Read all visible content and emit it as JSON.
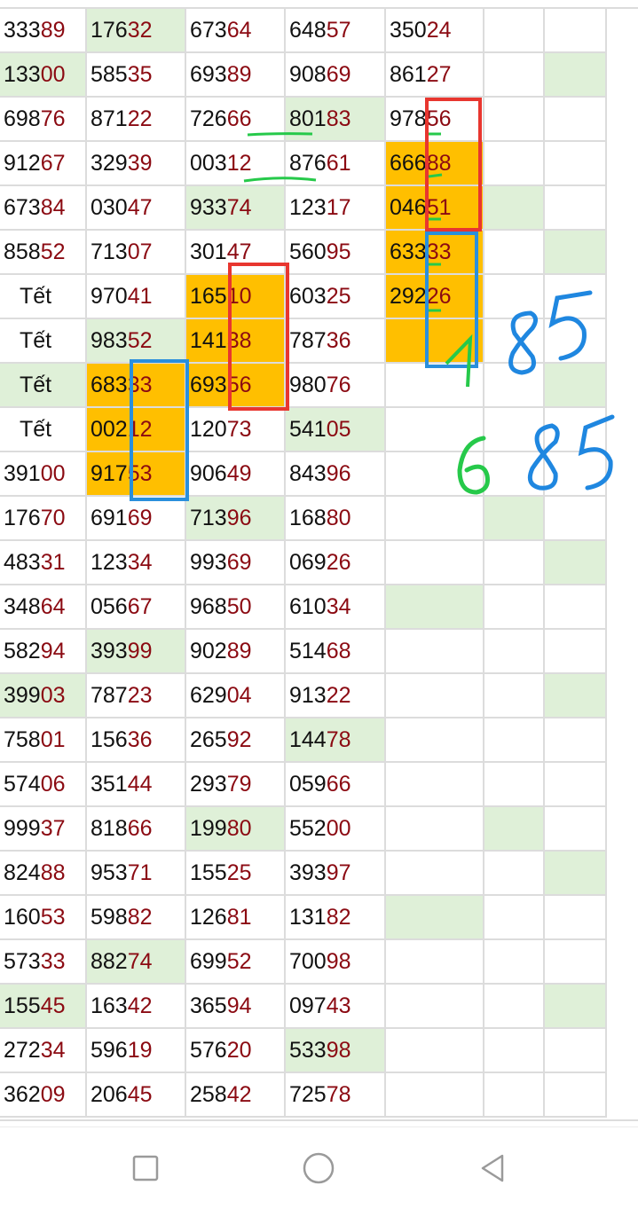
{
  "colors": {
    "grid_line": "#dcdcdc",
    "highlight_green": "#dff0d8",
    "highlight_orange": "#ffbf00",
    "tail_red": "#8b0a12",
    "box_red": "#e8362f",
    "box_blue": "#2a8fdc",
    "ink_green": "#26c94a",
    "ink_blue": "#1f87e0"
  },
  "table": {
    "rows": [
      [
        "33389",
        "17632",
        "67364",
        "64857",
        "35024",
        "",
        ""
      ],
      [
        "13300",
        "58535",
        "69389",
        "90869",
        "86127",
        "",
        ""
      ],
      [
        "69876",
        "87122",
        "72666",
        "80183",
        "97856",
        "",
        ""
      ],
      [
        "91267",
        "32939",
        "00312",
        "87661",
        "66688",
        "",
        ""
      ],
      [
        "67384",
        "03047",
        "93374",
        "12317",
        "04651",
        "",
        ""
      ],
      [
        "85852",
        "71307",
        "30147",
        "56095",
        "63333",
        "",
        ""
      ],
      [
        "Tết",
        "97041",
        "16510",
        "60325",
        "29226",
        "",
        ""
      ],
      [
        "Tết",
        "98352",
        "14138",
        "78736",
        "",
        "",
        ""
      ],
      [
        "Tết",
        "68333",
        "69356",
        "98076",
        "",
        "",
        ""
      ],
      [
        "Tết",
        "00212",
        "12073",
        "54105",
        "",
        "",
        ""
      ],
      [
        "39100",
        "91753",
        "90649",
        "84396",
        "",
        "",
        ""
      ],
      [
        "17670",
        "69169",
        "71396",
        "16880",
        "",
        "",
        ""
      ],
      [
        "48331",
        "12334",
        "99369",
        "06926",
        "",
        "",
        ""
      ],
      [
        "34864",
        "05667",
        "96850",
        "61034",
        "",
        "",
        ""
      ],
      [
        "58294",
        "39399",
        "90289",
        "51468",
        "",
        "",
        ""
      ],
      [
        "39903",
        "78723",
        "62904",
        "91322",
        "",
        "",
        ""
      ],
      [
        "75801",
        "15636",
        "26592",
        "14478",
        "",
        "",
        ""
      ],
      [
        "57406",
        "35144",
        "29379",
        "05966",
        "",
        "",
        ""
      ],
      [
        "99937",
        "81866",
        "19980",
        "55200",
        "",
        "",
        ""
      ],
      [
        "82488",
        "95371",
        "15525",
        "39397",
        "",
        "",
        ""
      ],
      [
        "16053",
        "59882",
        "12681",
        "13182",
        "",
        "",
        ""
      ],
      [
        "57333",
        "88274",
        "69952",
        "70098",
        "",
        "",
        ""
      ],
      [
        "15545",
        "16342",
        "36594",
        "09743",
        "",
        "",
        ""
      ],
      [
        "27234",
        "59619",
        "57620",
        "53398",
        "",
        "",
        ""
      ],
      [
        "36209",
        "20645",
        "25842",
        "72578",
        "",
        "",
        ""
      ]
    ],
    "green_cells": [
      [
        0,
        1
      ],
      [
        1,
        0
      ],
      [
        1,
        6
      ],
      [
        2,
        3
      ],
      [
        4,
        2
      ],
      [
        4,
        5
      ],
      [
        5,
        6
      ],
      [
        7,
        1
      ],
      [
        8,
        0
      ],
      [
        8,
        6
      ],
      [
        9,
        3
      ],
      [
        11,
        2
      ],
      [
        11,
        5
      ],
      [
        12,
        6
      ],
      [
        13,
        4
      ],
      [
        14,
        1
      ],
      [
        15,
        0
      ],
      [
        15,
        6
      ],
      [
        16,
        3
      ],
      [
        18,
        2
      ],
      [
        18,
        5
      ],
      [
        19,
        6
      ],
      [
        20,
        4
      ],
      [
        21,
        1
      ],
      [
        22,
        0
      ],
      [
        22,
        6
      ],
      [
        23,
        3
      ]
    ],
    "orange_cells": [
      [
        3,
        4
      ],
      [
        4,
        4
      ],
      [
        5,
        4
      ],
      [
        6,
        4
      ],
      [
        7,
        4
      ],
      [
        6,
        2
      ],
      [
        7,
        2
      ],
      [
        8,
        2
      ],
      [
        8,
        1
      ],
      [
        9,
        1
      ],
      [
        10,
        1
      ]
    ]
  },
  "annotations": {
    "handwriting_1": "1 85",
    "handwriting_2": "6 85"
  },
  "navbar": {
    "buttons": [
      {
        "name": "recent-apps-button",
        "icon": "square-icon"
      },
      {
        "name": "home-button",
        "icon": "circle-icon"
      },
      {
        "name": "back-button",
        "icon": "triangle-back-icon"
      }
    ]
  }
}
